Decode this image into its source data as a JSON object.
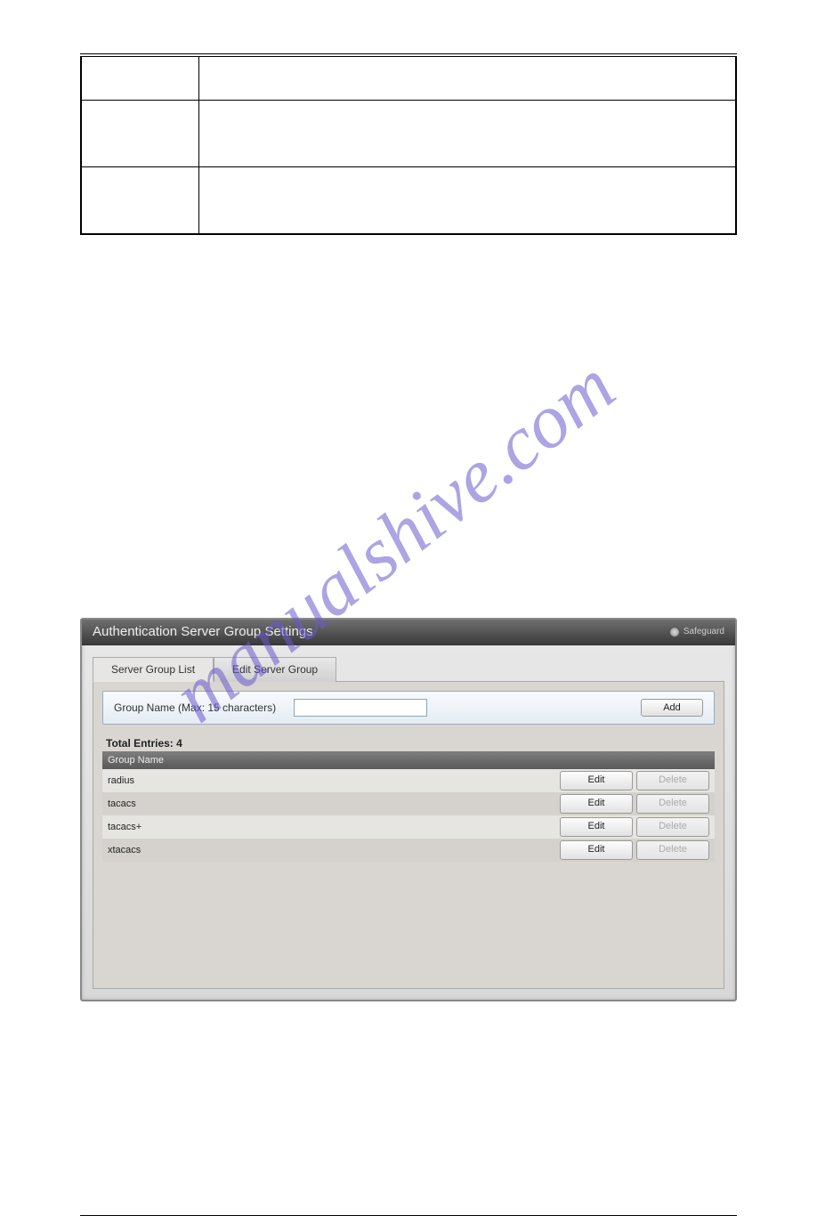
{
  "panel": {
    "title": "Authentication Server Group Settings",
    "safeguard_label": "Safeguard",
    "tabs": {
      "list": "Server Group List",
      "edit": "Edit Server Group"
    },
    "input": {
      "label": "Group Name  (Max: 15 characters)",
      "value": "",
      "add_btn": "Add"
    },
    "entries_label": "Total Entries: 4",
    "column_header": "Group Name",
    "rows": [
      {
        "name": "radius",
        "edit": "Edit",
        "del": "Delete",
        "del_disabled": true
      },
      {
        "name": "tacacs",
        "edit": "Edit",
        "del": "Delete",
        "del_disabled": true
      },
      {
        "name": "tacacs+",
        "edit": "Edit",
        "del": "Delete",
        "del_disabled": true
      },
      {
        "name": "xtacacs",
        "edit": "Edit",
        "del": "Delete",
        "del_disabled": true
      }
    ]
  },
  "watermark": "manualshive.com"
}
